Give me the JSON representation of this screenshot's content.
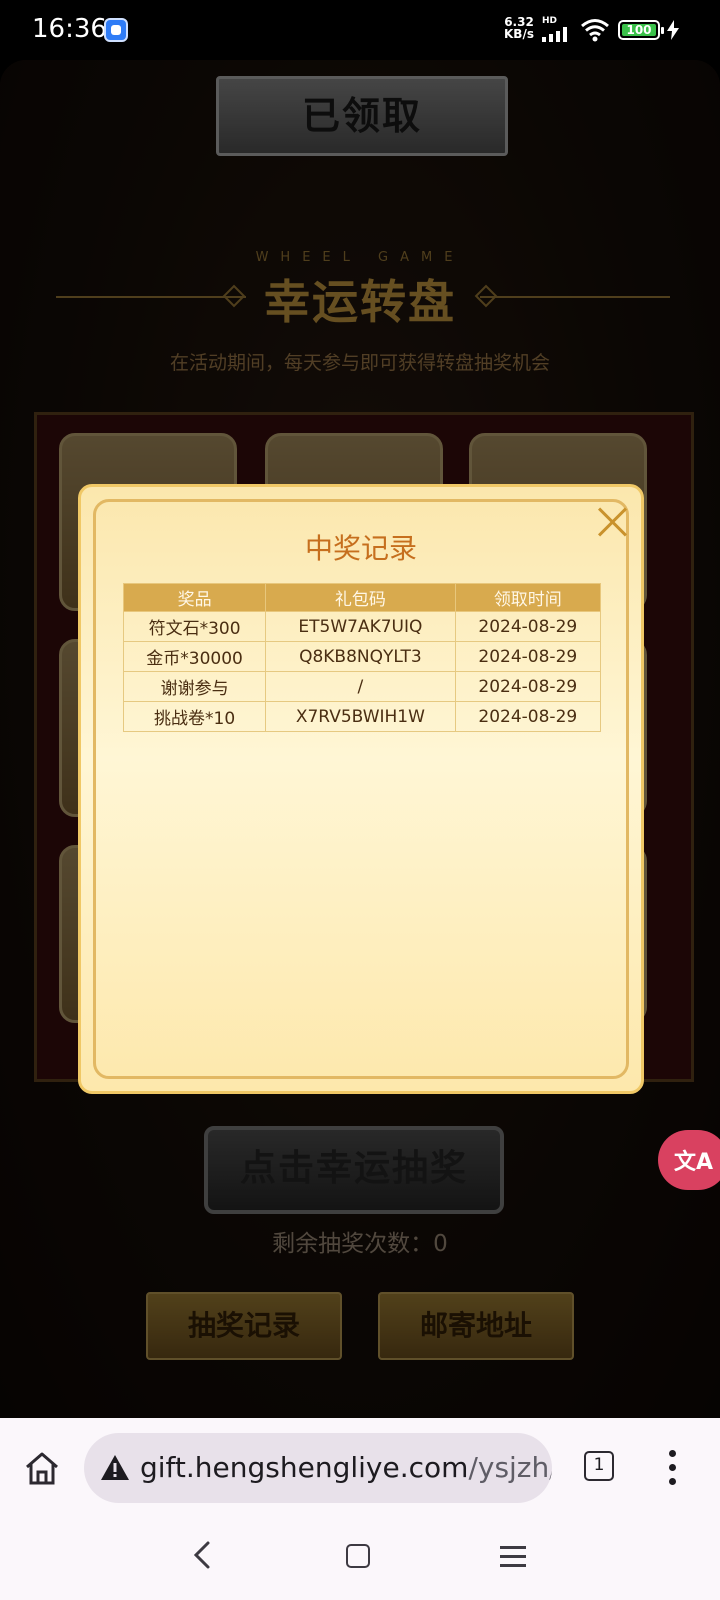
{
  "status_bar": {
    "time": "16:36",
    "net_speed_value": "6.32",
    "net_speed_unit": "KB/s",
    "network_label": "HD",
    "battery_level": "100"
  },
  "page": {
    "claimed_button_label": "已领取",
    "wheel_subtitle_en": "WHEEL GAME",
    "wheel_title": "幸运转盘",
    "wheel_description": "在活动期间，每天参与即可获得转盘抽奖机会",
    "draw_button_label": "点击幸运抽奖",
    "remaining_draws": "剩余抽奖次数：0",
    "records_button_label": "抽奖记录",
    "address_button_label": "邮寄地址"
  },
  "modal": {
    "title": "中奖记录",
    "columns": [
      "奖品",
      "礼包码",
      "领取时间"
    ],
    "rows": [
      [
        "符文石*300",
        "ET5W7AK7UIQ",
        "2024-08-29"
      ],
      [
        "金币*30000",
        "Q8KB8NQYLT3",
        "2024-08-29"
      ],
      [
        "谢谢参与",
        "/",
        "2024-08-29"
      ],
      [
        "挑战卷*10",
        "X7RV5BWIH1W",
        "2024-08-29"
      ]
    ]
  },
  "browser": {
    "url_host": "gift.hengshengliye.com",
    "url_path": "/ysjzh/ir",
    "tab_count": "1"
  },
  "colors": {
    "accent_gold": "#e2b04a",
    "modal_title": "#c66f1e",
    "fab_pink": "#d94160"
  }
}
